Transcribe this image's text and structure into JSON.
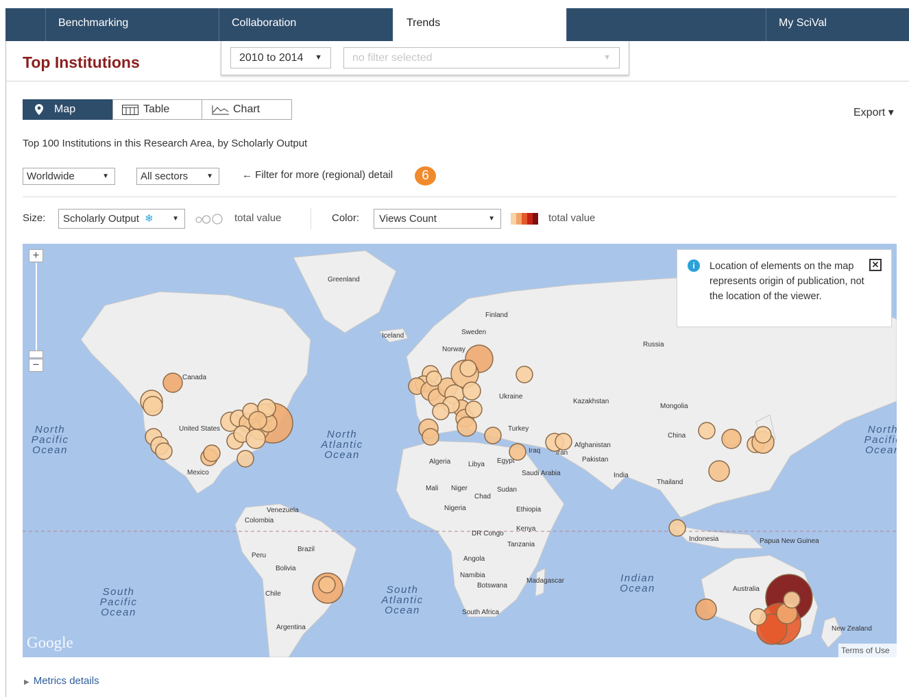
{
  "nav": {
    "tabs": [
      "Benchmarking",
      "Collaboration",
      "Trends",
      "My SciVal"
    ],
    "active": "Trends"
  },
  "page": {
    "title": "Top Institutions"
  },
  "filters": {
    "year_range": "2010 to 2014",
    "filter_placeholder": "no filter selected"
  },
  "view_tabs": [
    "Map",
    "Table",
    "Chart"
  ],
  "export_label": "Export ▾",
  "subtitle": "Top 100 Institutions in this Research Area, by Scholarly Output",
  "region_select": "Worldwide",
  "sector_select": "All sectors",
  "filter_hint": "← Filter for more (regional) detail",
  "step_badge": "6",
  "size_label": "Size:",
  "size_metric": "Scholarly Output",
  "size_legend": "total value",
  "color_label": "Color:",
  "color_metric": "Views Count",
  "color_legend": "total value",
  "map": {
    "zoom_in": "+",
    "zoom_out": "−",
    "info_text": "Location of elements on the map represents origin of publication, not the location of the viewer.",
    "attribution": "Google",
    "terms": "Terms of Use",
    "labels": [
      "Greenland",
      "Iceland",
      "Finland",
      "Sweden",
      "Norway",
      "Russia",
      "Canada",
      "United States",
      "Mexico",
      "Ukraine",
      "Kazakhstan",
      "Mongolia",
      "China",
      "Turkey",
      "Iraq",
      "Iran",
      "Afghanistan",
      "Pakistan",
      "India",
      "Thailand",
      "Algeria",
      "Libya",
      "Egypt",
      "Saudi Arabia",
      "Mali",
      "Niger",
      "Chad",
      "Sudan",
      "Nigeria",
      "Ethiopia",
      "Kenya",
      "DR Congo",
      "Tanzania",
      "Angola",
      "Namibia",
      "Botswana",
      "Madagascar",
      "South Africa",
      "Venezuela",
      "Colombia",
      "Peru",
      "Brazil",
      "Bolivia",
      "Chile",
      "Argentina",
      "Indonesia",
      "Papua New Guinea",
      "Australia",
      "New Zealand"
    ],
    "oceans": [
      "North Pacific Ocean",
      "North Atlantic Ocean",
      "South Pacific Ocean",
      "South Atlantic Ocean",
      "Indian Ocean"
    ]
  },
  "metrics_details": "Metrics details",
  "colors": {
    "nav": "#2e4d6b",
    "title": "#8b1f1f",
    "accent": "#f08a2c",
    "water": "#a9c5ea",
    "land": "#eeeeee"
  }
}
